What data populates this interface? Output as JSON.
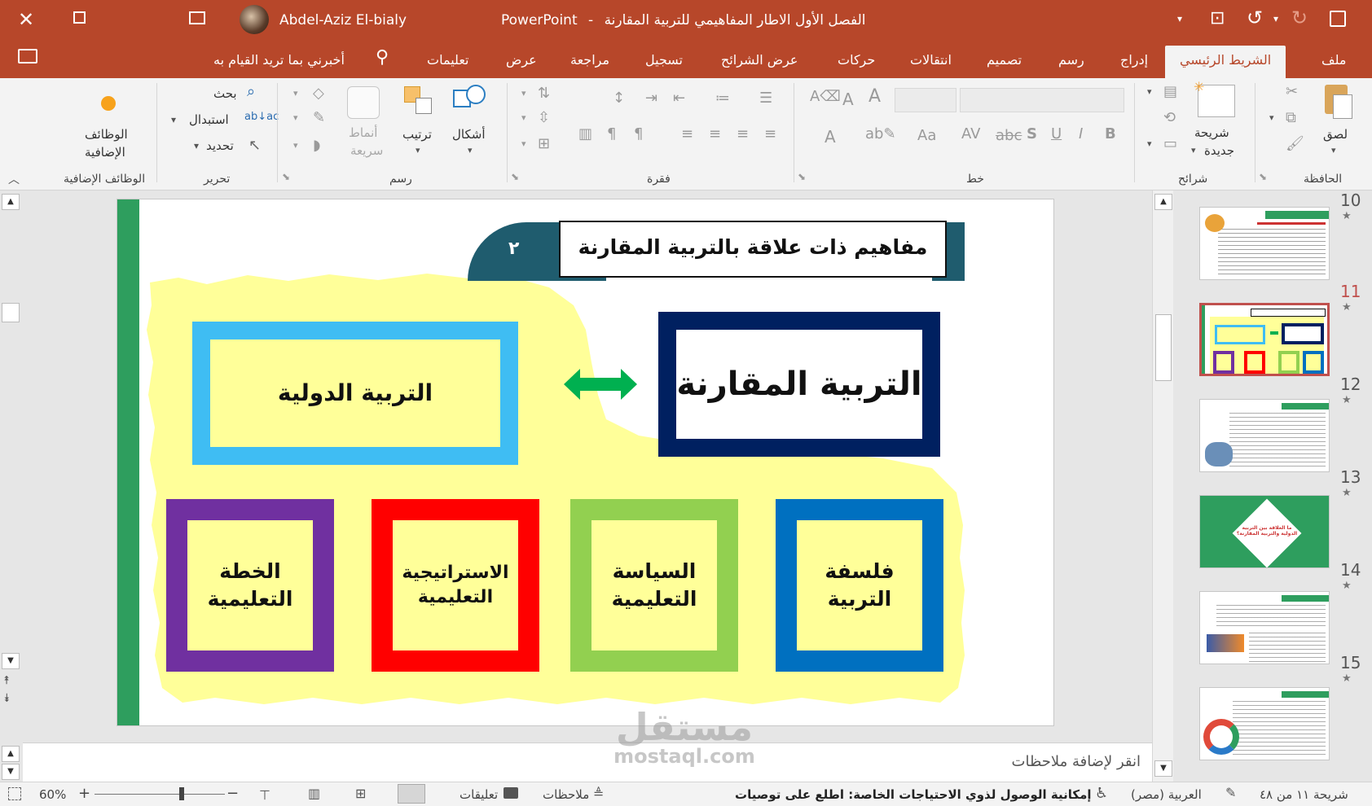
{
  "titlebar": {
    "user_name": "Abdel-Aziz El-bialy",
    "document_title": "الفصل الأول الاطار المفاهيمي للتربية المقارنة",
    "app_name": "PowerPoint",
    "separator": "-"
  },
  "ribbon_tabs": [
    {
      "label": "ملف"
    },
    {
      "label": "الشريط الرئيسي"
    },
    {
      "label": "إدراج"
    },
    {
      "label": "رسم"
    },
    {
      "label": "تصميم"
    },
    {
      "label": "انتقالات"
    },
    {
      "label": "حركات"
    },
    {
      "label": "عرض الشرائح"
    },
    {
      "label": "تسجيل"
    },
    {
      "label": "مراجعة"
    },
    {
      "label": "عرض"
    },
    {
      "label": "تعليمات"
    }
  ],
  "tell_me": "أخبرني بما تريد القيام به",
  "ribbon": {
    "clipboard": {
      "label": "الحافظة",
      "paste": "لصق"
    },
    "slides": {
      "label": "شرائح",
      "new_slide_1": "شريحة",
      "new_slide_2": "جديدة"
    },
    "font": {
      "label": "خط"
    },
    "paragraph": {
      "label": "فقرة"
    },
    "drawing": {
      "label": "رسم",
      "shapes": "أشكال",
      "arrange": "ترتيب",
      "quick_styles_1": "أنماط",
      "quick_styles_2": "سريعة"
    },
    "editing": {
      "label": "تحرير",
      "find": "بحث",
      "replace": "استبدال",
      "select": "تحديد"
    },
    "addins": {
      "label": "الوظائف الإضافية",
      "button_1": "الوظائف",
      "button_2": "الإضافية"
    }
  },
  "slide": {
    "title": "مفاهيم ذات علاقة بالتربية المقارنة",
    "number": "٢",
    "main_box": "التربية المقارنة",
    "secondary_box": "التربية الدولية",
    "bottom_boxes": [
      {
        "line1": "فلسفة",
        "line2": "التربية",
        "color": "#0070c0"
      },
      {
        "line1": "السياسة",
        "line2": "التعليمية",
        "color": "#92d050"
      },
      {
        "line1": "الاستراتيجية",
        "line2": "التعليمية",
        "color": "#ff0000"
      },
      {
        "line1": "الخطة",
        "line2": "التعليمية",
        "color": "#7030a0"
      }
    ],
    "colors": {
      "main_frame": "#002060",
      "secondary_frame": "#3fbdf3",
      "fill": "#ffff99",
      "arrow": "#00b050",
      "header": "#1f5c6e",
      "left_bar": "#2e9e5e"
    }
  },
  "notes_placeholder": "انقر لإضافة ملاحظات",
  "thumbnails": [
    {
      "number": "10",
      "current": false
    },
    {
      "number": "11",
      "current": true
    },
    {
      "number": "12",
      "current": false
    },
    {
      "number": "13",
      "current": false
    },
    {
      "number": "14",
      "current": false
    },
    {
      "number": "15",
      "current": false
    }
  ],
  "thumb13_text": "ما العلاقة بين التربية الدولية والتربية المقارنة؟",
  "statusbar": {
    "slide_info": "شريحة ١١ من ٤٨",
    "language": "العربية (مصر)",
    "accessibility": "إمكانية الوصول لذوي الاحتياجات الخاصة: اطلع على توصيات",
    "notes": "ملاحظات",
    "comments": "تعليقات",
    "zoom": "60%"
  },
  "watermark": {
    "line1": "مستقل",
    "line2": "mostaql.com"
  }
}
